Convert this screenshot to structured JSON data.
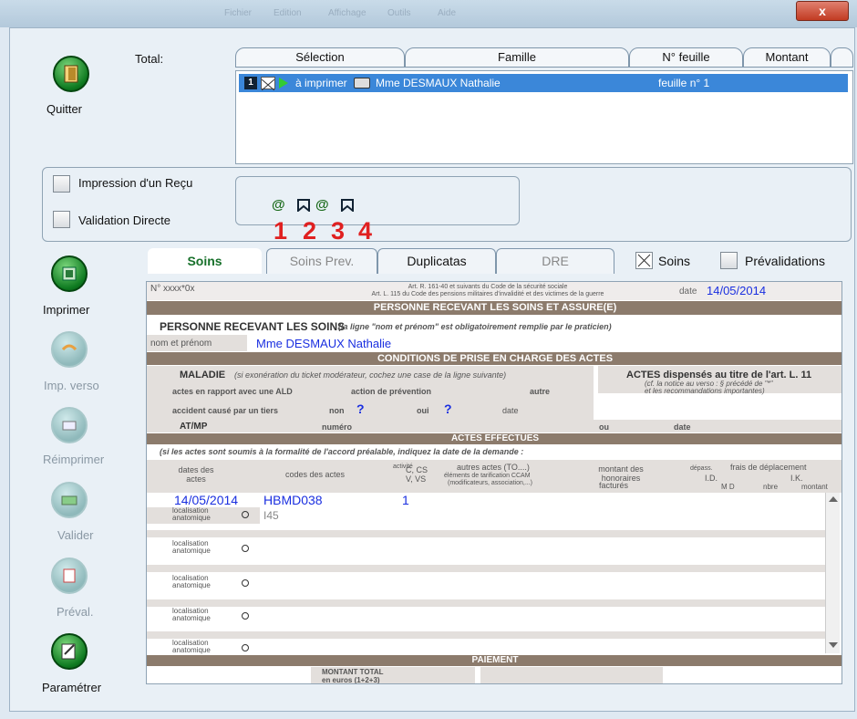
{
  "window": {
    "close_label": "x",
    "blur_text": [
      "Fichier",
      "Edition",
      "Affichage",
      "Outils",
      "Aide"
    ]
  },
  "sidebar": {
    "quit": "Quitter",
    "print": "Imprimer",
    "print_verso": "Imp. verso",
    "reprint": "Réimprimer",
    "validate": "Valider",
    "preval": "Préval.",
    "settings": "Paramétrer"
  },
  "top": {
    "total_label": "Total:",
    "columns": [
      "Sélection",
      "Famille",
      "N° feuille",
      "Montant"
    ],
    "row": {
      "badge": "1",
      "status": "à imprimer",
      "famille": "Mme DESMAUX Nathalie",
      "feuille": "feuille n° 1"
    }
  },
  "options": {
    "receipt": "Impression d'un Reçu",
    "direct": "Validation Directe",
    "callouts": [
      "1",
      "2",
      "3",
      "4"
    ]
  },
  "tabs": {
    "soins": "Soins",
    "soins_prev": "Soins Prev.",
    "duplicatas": "Duplicatas",
    "dre": "DRE",
    "chk_soins": "Soins",
    "chk_preval": "Prévalidations"
  },
  "form": {
    "n_label": "N° xxxx*0x",
    "art_line1": "Art. R. 161-40 et suivants du Code de la sécurité sociale",
    "art_line2": "Art. L. 115 du Code des pensions militaires d'invalidité et des victimes de la guerre",
    "date_label": "date",
    "date_value": "14/05/2014",
    "sec_person": "PERSONNE RECEVANT LES SOINS ET ASSURE(E)",
    "person_heading": "PERSONNE RECEVANT LES SOINS",
    "person_note": "(la ligne \"nom et prénom\" est obligatoirement remplie par le praticien)",
    "name_label": "nom et prénom",
    "name_value": "Mme DESMAUX Nathalie",
    "sec_conditions": "CONDITIONS DE PRISE EN CHARGE DES ACTES",
    "maladie": "MALADIE",
    "maladie_note": "(si exonération du ticket modérateur, cochez une case de la ligne suivante)",
    "ald": "actes en rapport avec une ALD",
    "prevention": "action de prévention",
    "autre": "autre",
    "accident": "accident causé par un tiers",
    "non": "non",
    "oui": "oui",
    "q": "?",
    "date": "date",
    "actes_art": "ACTES dispensés au titre de l'art. L. 11",
    "actes_note1": "(cf. la notice au verso : § précédé de \"*\"",
    "actes_note2": "et les recommandations importantes)",
    "atmp": "AT/MP",
    "numero": "numéro",
    "ou": "ou",
    "date2": "date",
    "sec_actes": "ACTES EFFECTUES",
    "accord_note": "(si les actes sont soumis à la formalité de l'accord préalable, indiquez la date de la demande :",
    "col_dates": "dates des actes",
    "col_codes": "codes des actes",
    "col_activite": "activité",
    "col_ccs": "C, CS V, VS",
    "col_autres": "autres actes (TO....)",
    "col_autres2": "éléments de tarification CCAM",
    "col_autres3": "(modificateurs, association,...)",
    "col_montant": "montant des honoraires",
    "col_montant2": "facturés",
    "col_depass": "dépass.",
    "col_frais": "frais de déplacement",
    "col_id": "I.D.",
    "col_ik": "I.K.",
    "col_md": "M D",
    "col_nbre": "nbre",
    "col_mont": "montant",
    "act_date": "14/05/2014",
    "act_code": "HBMD038",
    "act_activite": "1",
    "loc1": "localisation",
    "loc2": "anatomique",
    "loc_value": "I45",
    "sec_paiement": "PAIEMENT",
    "total1": "MONTANT TOTAL",
    "total2": "en euros (1+2+3)"
  },
  "colors": {
    "accent": "#3b87d9",
    "brown": "#8c7b6c",
    "blue_text": "#1a2fe0",
    "callout": "#e02020"
  }
}
